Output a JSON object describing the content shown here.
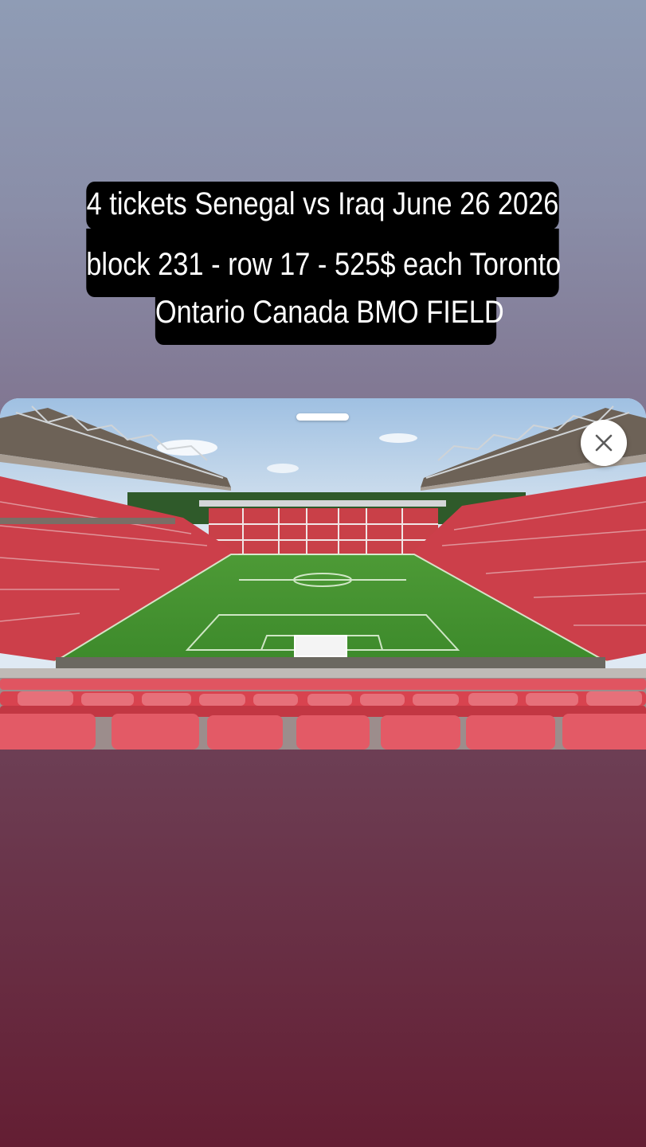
{
  "story_caption": {
    "lines": [
      "4 tickets Senegal vs Iraq June 26 2026",
      "block 231 - row 17 - 525$ each Toronto",
      "Ontario Canada BMO FIELD"
    ]
  },
  "media_card": {
    "image": "stadium-view-photo",
    "close_icon": "close-icon",
    "handle_icon": "drag-handle"
  },
  "colors": {
    "caption_bg": "#000000",
    "caption_text": "#ffffff",
    "seat_red": "#d8434f",
    "pitch_green": "#3f8a2e"
  }
}
